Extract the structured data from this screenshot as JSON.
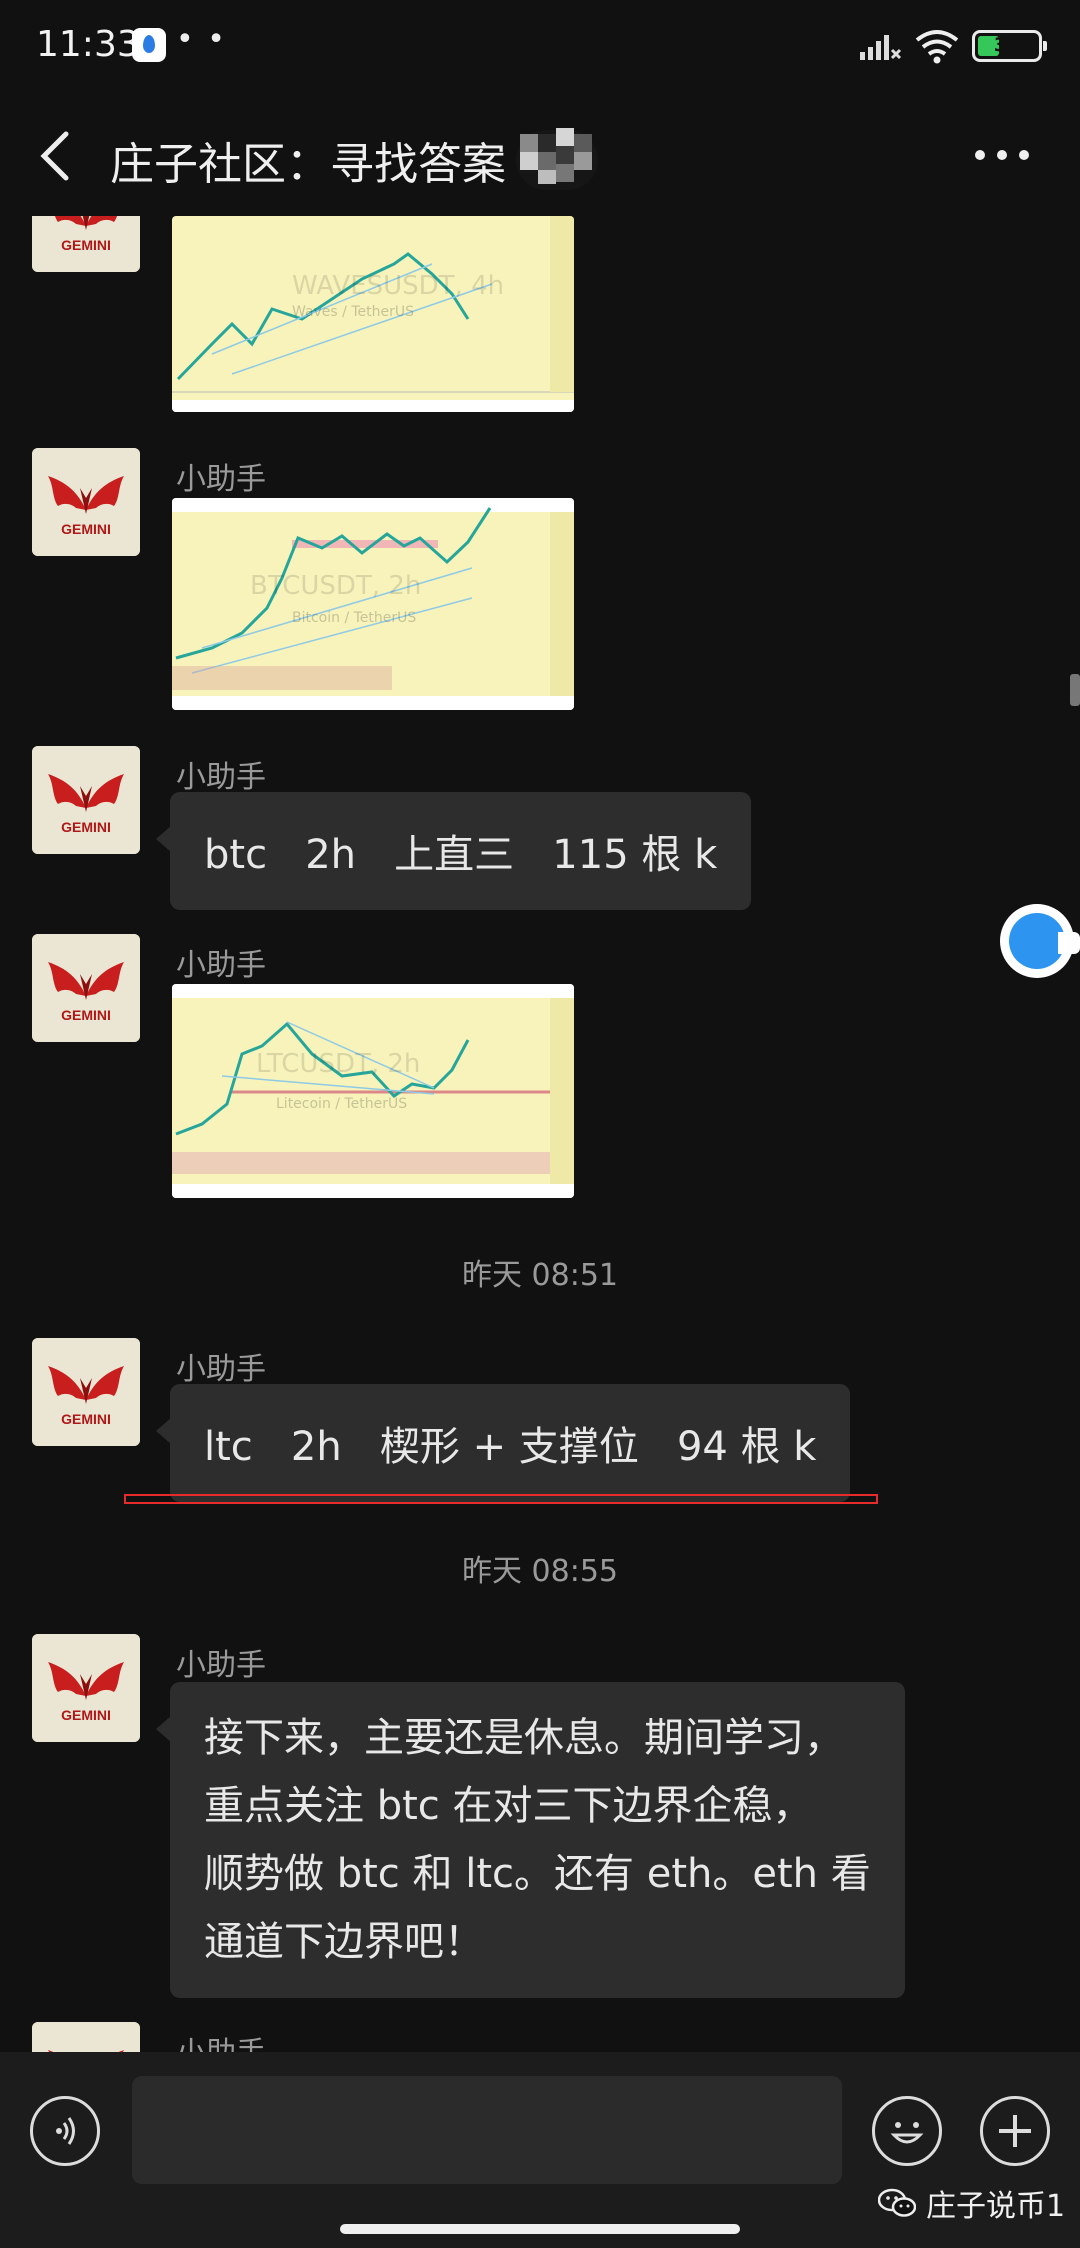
{
  "status_bar": {
    "time": "11:33",
    "dots": "• •",
    "battery": "37",
    "battery_level": 0.37
  },
  "nav": {
    "title": "庄子社区：寻找答案",
    "back_icon": "chevron-left-icon",
    "more_icon": "more-horizontal-icon"
  },
  "chat": {
    "sender": "小助手",
    "avatar_label": "GEMINI",
    "msg_chart_top_label": "WAVESUSDT, 4h",
    "msg_chart_top_sub": "Waves / TetherUS",
    "msg_chart_btc_label": "BTCUSDT, 2h",
    "msg_chart_btc_sub": "Bitcoin / TetherUS",
    "msg_btc_text": "btc   2h   上直三   115 根 k",
    "msg_chart_ltc_label": "LTCUSDT, 2h",
    "msg_chart_ltc_sub": "Litecoin / TetherUS",
    "time_1": "昨天 08:51",
    "msg_ltc_text": "ltc   2h   楔形 + 支撑位   94 根 k",
    "time_2": "昨天 08:55",
    "msg_long_text": "接下来，主要还是休息。期间学习，\n重点关注 btc 在对三下边界企稳，\n顺势做 btc 和 ltc。还有 eth。eth 看\n通道下边界吧！",
    "accent_highlight": "#e52b2b"
  },
  "input_bar": {
    "placeholder": "",
    "voice_icon": "voice-icon",
    "emoji_icon": "emoji-icon",
    "plus_icon": "plus-icon"
  },
  "watermark": {
    "text": "庄子说币1",
    "icon": "wechat-icon"
  },
  "colors": {
    "background": "#111111",
    "bubble": "#2d2d2d",
    "chart_bg": "#f7f3bb",
    "float_button": "#2d95f0"
  }
}
